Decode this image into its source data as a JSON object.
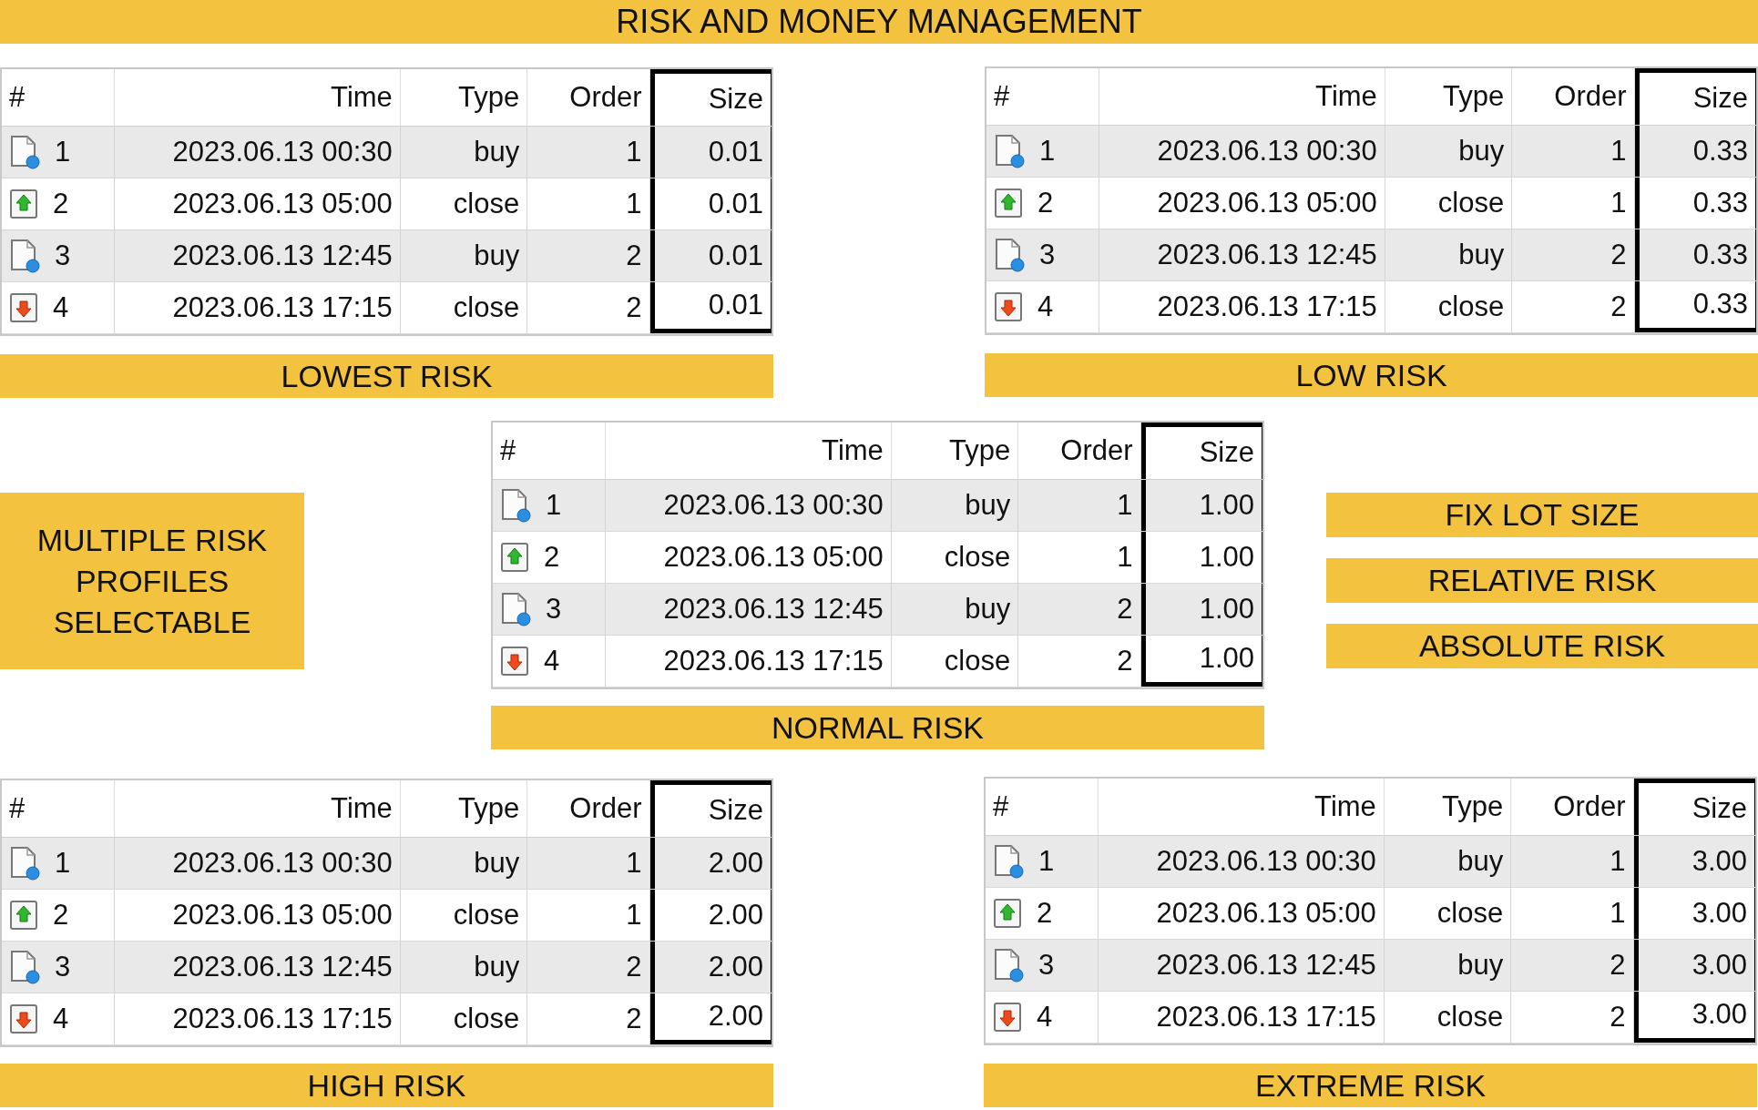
{
  "title": "RISK AND MONEY MANAGEMENT",
  "panels": [
    {
      "label": "LOWEST RISK",
      "columns": [
        "#",
        "Time",
        "Type",
        "Order",
        "Size"
      ],
      "rows": [
        {
          "kind": "document",
          "number": "1",
          "time": "2023.06.13 00:30",
          "type": "buy",
          "order": "1",
          "size": "0.01"
        },
        {
          "kind": "up",
          "number": "2",
          "time": "2023.06.13 05:00",
          "type": "close",
          "order": "1",
          "size": "0.01"
        },
        {
          "kind": "document",
          "number": "3",
          "time": "2023.06.13 12:45",
          "type": "buy",
          "order": "2",
          "size": "0.01"
        },
        {
          "kind": "down",
          "number": "4",
          "time": "2023.06.13 17:15",
          "type": "close",
          "order": "2",
          "size": "0.01"
        }
      ]
    },
    {
      "label": "LOW RISK",
      "columns": [
        "#",
        "Time",
        "Type",
        "Order",
        "Size"
      ],
      "rows": [
        {
          "kind": "document",
          "number": "1",
          "time": "2023.06.13 00:30",
          "type": "buy",
          "order": "1",
          "size": "0.33"
        },
        {
          "kind": "up",
          "number": "2",
          "time": "2023.06.13 05:00",
          "type": "close",
          "order": "1",
          "size": "0.33"
        },
        {
          "kind": "document",
          "number": "3",
          "time": "2023.06.13 12:45",
          "type": "buy",
          "order": "2",
          "size": "0.33"
        },
        {
          "kind": "down",
          "number": "4",
          "time": "2023.06.13 17:15",
          "type": "close",
          "order": "2",
          "size": "0.33"
        }
      ]
    },
    {
      "label": "NORMAL RISK",
      "columns": [
        "#",
        "Time",
        "Type",
        "Order",
        "Size"
      ],
      "rows": [
        {
          "kind": "document",
          "number": "1",
          "time": "2023.06.13 00:30",
          "type": "buy",
          "order": "1",
          "size": "1.00"
        },
        {
          "kind": "up",
          "number": "2",
          "time": "2023.06.13 05:00",
          "type": "close",
          "order": "1",
          "size": "1.00"
        },
        {
          "kind": "document",
          "number": "3",
          "time": "2023.06.13 12:45",
          "type": "buy",
          "order": "2",
          "size": "1.00"
        },
        {
          "kind": "down",
          "number": "4",
          "time": "2023.06.13 17:15",
          "type": "close",
          "order": "2",
          "size": "1.00"
        }
      ]
    },
    {
      "label": "HIGH RISK",
      "columns": [
        "#",
        "Time",
        "Type",
        "Order",
        "Size"
      ],
      "rows": [
        {
          "kind": "document",
          "number": "1",
          "time": "2023.06.13 00:30",
          "type": "buy",
          "order": "1",
          "size": "2.00"
        },
        {
          "kind": "up",
          "number": "2",
          "time": "2023.06.13 05:00",
          "type": "close",
          "order": "1",
          "size": "2.00"
        },
        {
          "kind": "document",
          "number": "3",
          "time": "2023.06.13 12:45",
          "type": "buy",
          "order": "2",
          "size": "2.00"
        },
        {
          "kind": "down",
          "number": "4",
          "time": "2023.06.13 17:15",
          "type": "close",
          "order": "2",
          "size": "2.00"
        }
      ]
    },
    {
      "label": "EXTREME RISK",
      "columns": [
        "#",
        "Time",
        "Type",
        "Order",
        "Size"
      ],
      "rows": [
        {
          "kind": "document",
          "number": "1",
          "time": "2023.06.13 00:30",
          "type": "buy",
          "order": "1",
          "size": "3.00"
        },
        {
          "kind": "up",
          "number": "2",
          "time": "2023.06.13 05:00",
          "type": "close",
          "order": "1",
          "size": "3.00"
        },
        {
          "kind": "document",
          "number": "3",
          "time": "2023.06.13 12:45",
          "type": "buy",
          "order": "2",
          "size": "3.00"
        },
        {
          "kind": "down",
          "number": "4",
          "time": "2023.06.13 17:15",
          "type": "close",
          "order": "2",
          "size": "3.00"
        }
      ]
    }
  ],
  "side_note": "MULTIPLE RISK\nPROFILES\nSELECTABLE",
  "modes": [
    "FIX LOT SIZE",
    "RELATIVE RISK",
    "ABSOLUTE RISK"
  ]
}
